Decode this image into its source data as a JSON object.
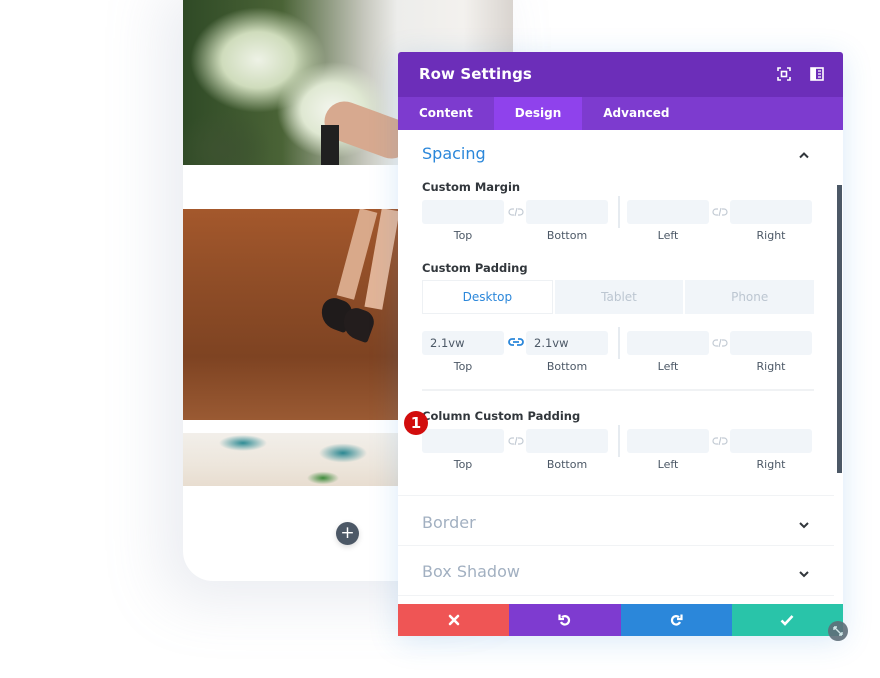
{
  "preview": {
    "add_row_icon": "+",
    "images": [
      "bouquet-photo",
      "shoes-on-floor-photo",
      "table-setting-photo"
    ]
  },
  "panel": {
    "title": "Row Settings",
    "header_icons": [
      "expand-icon",
      "split-view-icon"
    ],
    "tabs": [
      {
        "label": "Content",
        "active": false
      },
      {
        "label": "Design",
        "active": true
      },
      {
        "label": "Advanced",
        "active": false
      }
    ],
    "sections": {
      "spacing": {
        "title": "Spacing",
        "expanded": true,
        "custom_margin": {
          "label": "Custom Margin",
          "top": "",
          "bottom": "",
          "left": "",
          "right": "",
          "labels": [
            "Top",
            "Bottom",
            "Left",
            "Right"
          ],
          "linked_top_bottom": false,
          "linked_left_right": false
        },
        "custom_padding": {
          "label": "Custom Padding",
          "devices": [
            {
              "label": "Desktop",
              "active": true
            },
            {
              "label": "Tablet",
              "active": false
            },
            {
              "label": "Phone",
              "active": false
            }
          ],
          "top": "2.1vw",
          "bottom": "2.1vw",
          "left": "",
          "right": "",
          "labels": [
            "Top",
            "Bottom",
            "Left",
            "Right"
          ],
          "linked_top_bottom": true,
          "linked_left_right": false,
          "step_badge": "1"
        },
        "column_custom_padding": {
          "label": "Column Custom Padding",
          "top": "",
          "bottom": "",
          "left": "",
          "right": "",
          "labels": [
            "Top",
            "Bottom",
            "Left",
            "Right"
          ]
        }
      },
      "border": {
        "title": "Border",
        "expanded": false
      },
      "box_shadow": {
        "title": "Box Shadow",
        "expanded": false
      }
    },
    "footer": {
      "cancel": "close-icon",
      "undo": "undo-icon",
      "redo": "redo-icon",
      "save": "check-icon"
    },
    "colors": {
      "header": "#6c2eb9",
      "tabs": "#7d3bcf",
      "active_tab": "#8f42ec",
      "accent_blue": "#2b87da",
      "cancel": "#ef5555",
      "undo": "#7e3bd0",
      "redo": "#2b87da",
      "save": "#29c4a9",
      "badge": "#d20d0d"
    }
  }
}
